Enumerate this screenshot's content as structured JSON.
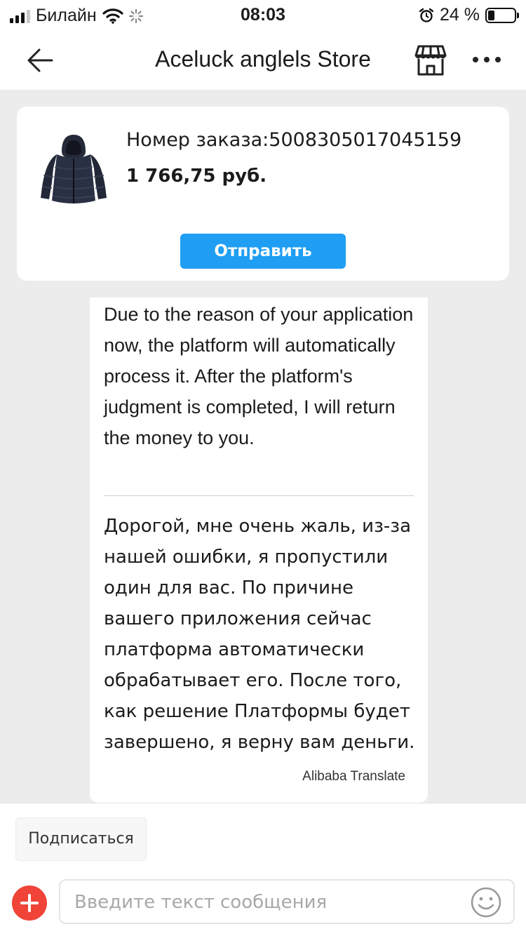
{
  "status_bar": {
    "carrier": "Билайн",
    "time": "08:03",
    "battery_percent": "24 %",
    "battery_level": 0.24,
    "signal_bars": 3,
    "signal_max": 4
  },
  "header": {
    "title": "Aceluck anglels Store",
    "back_icon": "arrow-left-icon",
    "store_icon": "storefront-icon",
    "more_icon": "more-dots-icon"
  },
  "order_card": {
    "order_number": "Номер заказа:5008305017045159",
    "price": "1 766,75 руб.",
    "send_label": "Отправить",
    "thumbnail_icon": "jacket-product-image"
  },
  "message": {
    "original_text": "Due to the reason of your application now, the platform will automatically process it. After the platform's judgment is completed, I will return the money to you.",
    "translated_text": "Дорогой, мне очень жаль, из-за нашей ошибки, я пропустили один для вас. По причине вашего приложения сейчас платформа автоматически обрабатывает его. После того, как решение Платформы будет завершено, я верну вам деньги.",
    "translate_credit": "Alibaba Translate"
  },
  "bottom_bar": {
    "subscribe_label": "Подписаться",
    "input_placeholder": "Введите текст сообщения",
    "add_icon": "plus-circle-icon",
    "emoji_icon": "smiley-icon"
  },
  "colors": {
    "accent_blue": "#1f9ef3",
    "add_red": "#f04438",
    "chat_background": "#ececec"
  }
}
